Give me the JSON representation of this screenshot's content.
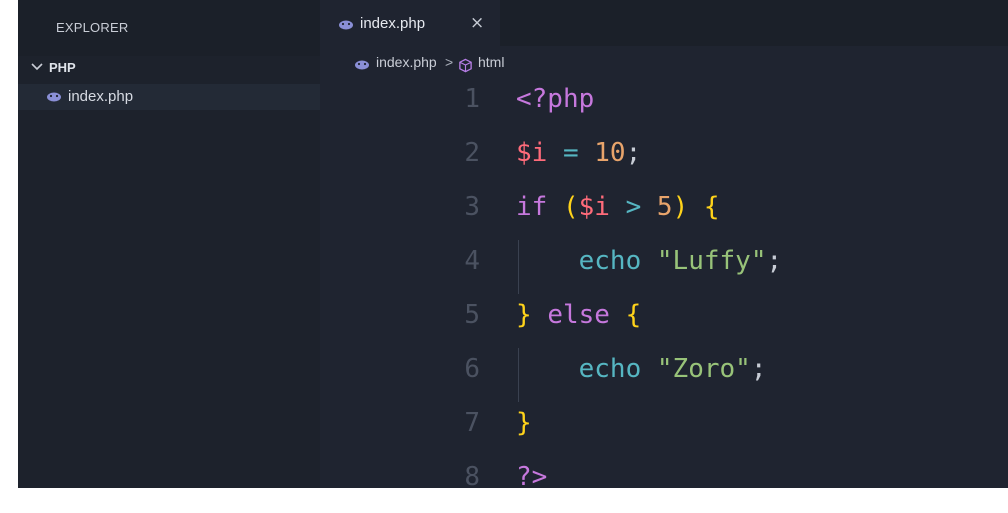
{
  "sidebar": {
    "title": "EXPLORER",
    "folder": "PHP",
    "files": [
      "index.php"
    ]
  },
  "editor": {
    "tab": {
      "label": "index.php",
      "close": "×"
    },
    "breadcrumb": {
      "file": "index.php",
      "separator": ">",
      "symbol": "html"
    }
  },
  "code_lines": [
    {
      "n": "1",
      "text": "<?php"
    },
    {
      "n": "2",
      "text": "$i = 10;"
    },
    {
      "n": "3",
      "text": "if ($i > 5) {"
    },
    {
      "n": "4",
      "text": "    echo \"Luffy\";"
    },
    {
      "n": "5",
      "text": "} else {"
    },
    {
      "n": "6",
      "text": "    echo \"Zoro\";"
    },
    {
      "n": "7",
      "text": "}"
    },
    {
      "n": "8",
      "text": "?>"
    }
  ],
  "colors": {
    "background": "#1f2430",
    "sidebar": "#1d222c",
    "keyword": "#c678dd",
    "variable": "#ff6b7a",
    "number": "#e8a46b",
    "string": "#98c379",
    "brace": "#ffd31a"
  },
  "icons": [
    "php-elephant-icon",
    "chevron-down-icon",
    "close-icon",
    "cube-icon"
  ]
}
